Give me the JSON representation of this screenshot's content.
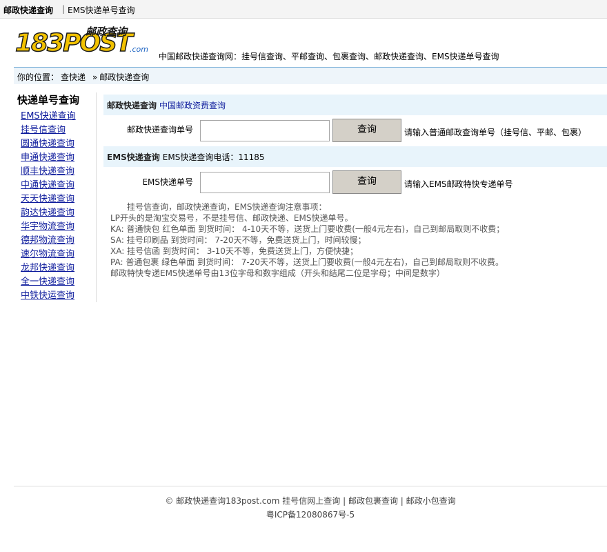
{
  "topbar": {
    "title": "邮政快递查询",
    "separator": "|",
    "link": "EMS快递单号查询"
  },
  "logo": {
    "number_text": "183POST",
    "subtitle": "邮政查询",
    "domain": ".com"
  },
  "header": {
    "tagline": "中国邮政快递查询网：挂号信查询、平邮查询、包裹查询、邮政快递查询、EMS快递单号查询"
  },
  "breadcrumb": {
    "prefix": "你的位置：",
    "item1": "查快递",
    "arrow": "»",
    "item2": "邮政快递查询"
  },
  "sidebar": {
    "title": "快递单号查询",
    "items": [
      "EMS快递查询",
      "挂号信查询",
      "圆通快递查询",
      "申通快递查询",
      "顺丰快递查询",
      "中通快递查询",
      "天天快递查询",
      "韵达快递查询",
      "华宇物流查询",
      "德邦物流查询",
      "速尔物流查询",
      "龙邦快递查询",
      "全一快递查询",
      "中铁快运查询"
    ]
  },
  "postal_section": {
    "title": "邮政快递查询",
    "link": "中国邮政资费查询",
    "field_label": "邮政快递查询单号",
    "field_value": "",
    "button": "查询",
    "hint": "请输入普通邮政查询单号（挂号信、平邮、包裹）"
  },
  "ems_section": {
    "title": "EMS快递查询",
    "phone": "EMS快递查询电话：11185",
    "field_label": "EMS快递单号",
    "field_value": "",
    "button": "查询",
    "hint": "请输入EMS邮政特快专递单号"
  },
  "notes": {
    "heading": "挂号信查询，邮政快递查询，EMS快递查询注意事项：",
    "lines": [
      "LP开头的是淘宝交易号，不是挂号信、邮政快递、EMS快递单号。",
      "KA: 普通快包  红色单面  到货时间：  4-10天不等，送货上门要收费(一般4元左右)，自己到邮局取则不收费；",
      "SA: 挂号印刷品  到货时间：  7-20天不等，免费送货上门，时间较慢；",
      "XA: 挂号信函  到货时间：  3-10天不等，免费送货上门，方便快捷；",
      "PA: 普通包裹  绿色单面  到货时间：  7-20天不等，送货上门要收费(一般4元左右)，自己到邮局取则不收费。",
      "邮政特快专递EMS快递单号由13位字母和数字组成（开头和结尾二位是字母；中间是数字）"
    ]
  },
  "footer": {
    "copyright": "© 邮政快递查询183post.com",
    "links": [
      "挂号信网上查询",
      "邮政包裹查询",
      "邮政小包查询"
    ],
    "separator": "|",
    "icp": "粤ICP备12080867号-5"
  }
}
